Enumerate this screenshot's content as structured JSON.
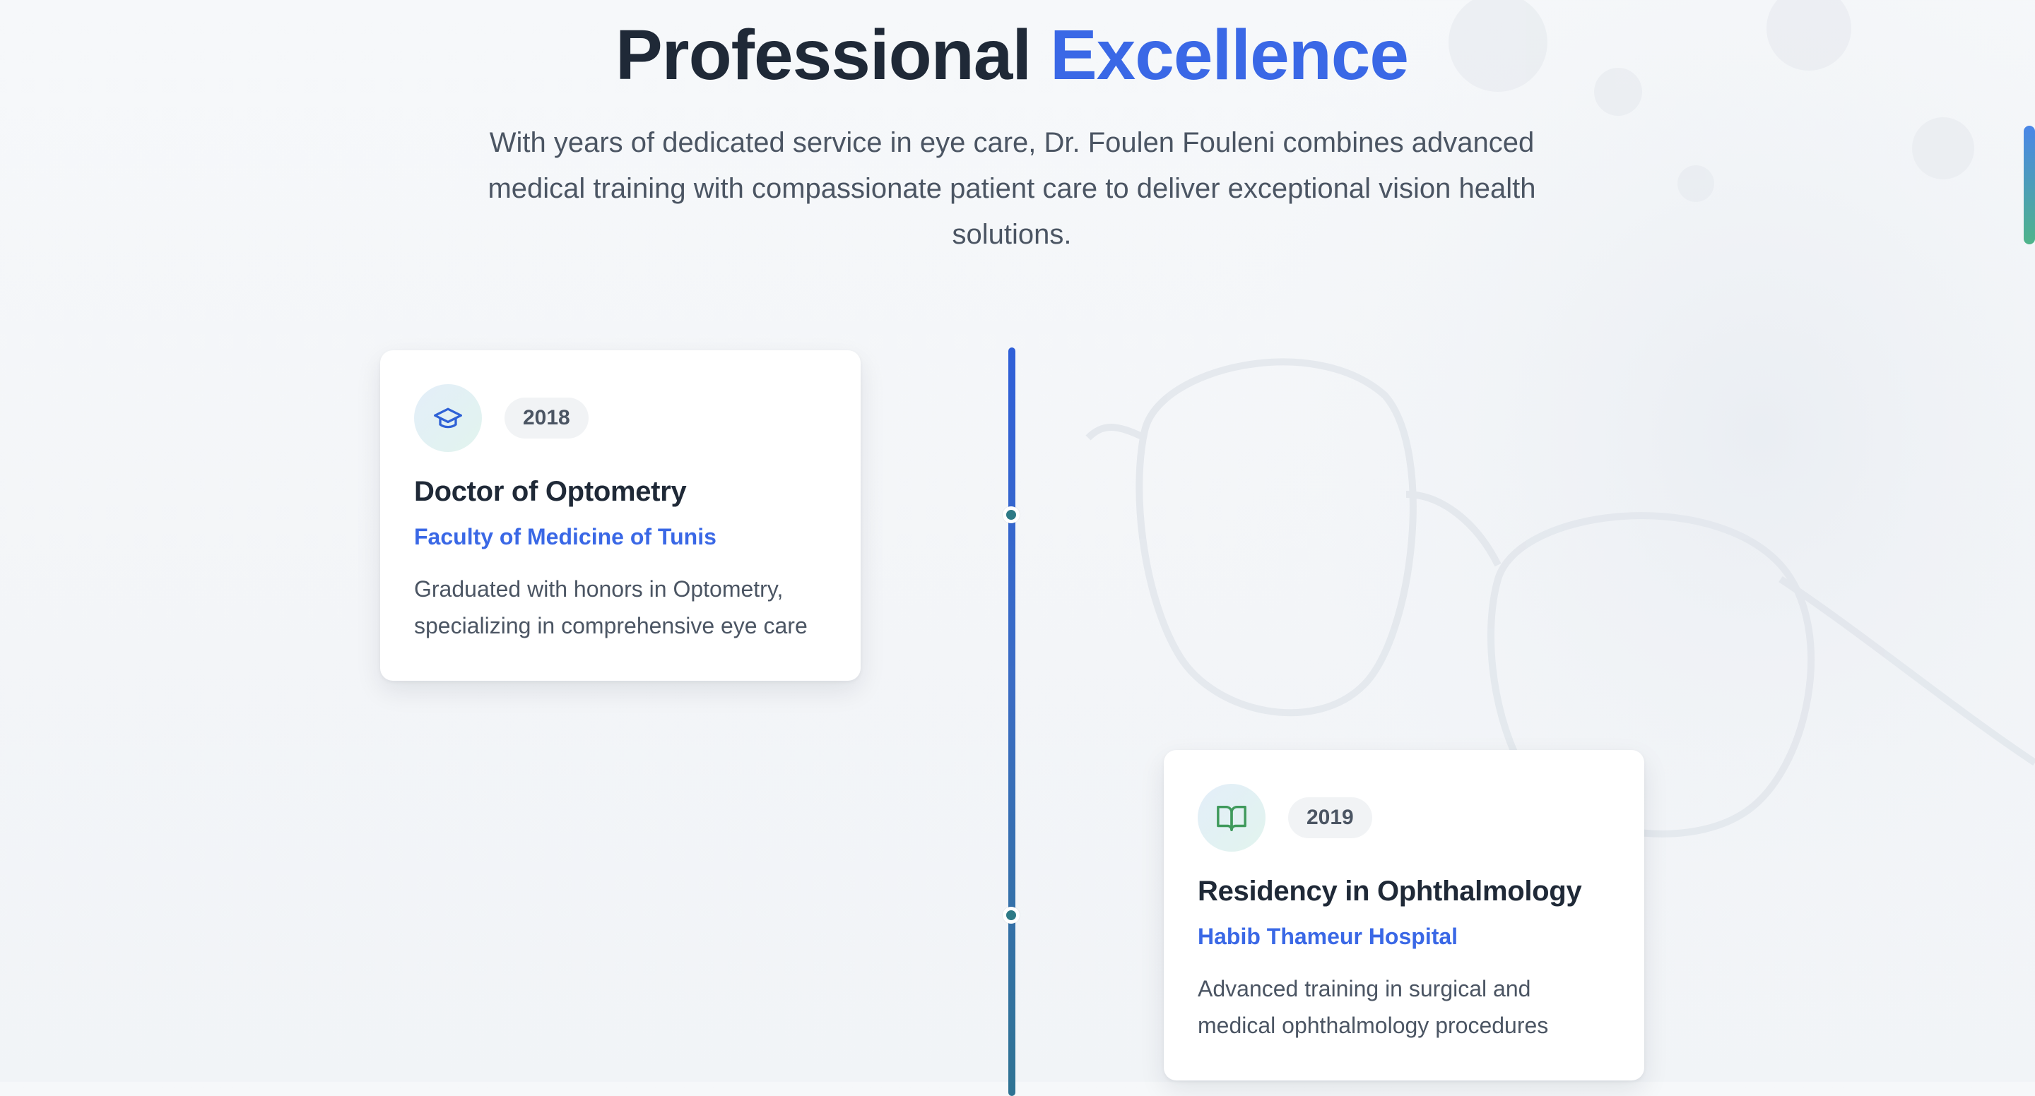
{
  "header": {
    "title_part1": "Professional",
    "title_part2": "Excellence",
    "intro": "With years of dedicated service in eye care, Dr. Foulen Fouleni combines advanced medical training with compassionate patient care to deliver exceptional vision health solutions."
  },
  "timeline": [
    {
      "icon": "graduation-cap-icon",
      "year": "2018",
      "title": "Doctor of Optometry",
      "organization": "Faculty of Medicine of Tunis",
      "description": "Graduated with honors in Optometry, specializing in comprehensive eye care"
    },
    {
      "icon": "open-book-icon",
      "year": "2019",
      "title": "Residency in Ophthalmology",
      "organization": "Habib Thameur Hospital",
      "description": "Advanced training in surgical and medical ophthalmology procedures"
    }
  ],
  "colors": {
    "accent": "#3a68e6",
    "heading": "#1f2937",
    "body_text": "#4b5563",
    "timeline_top": "#2f5fd8",
    "timeline_bottom": "#2f7393",
    "scroll_top": "#4a86e8",
    "scroll_bottom": "#4fb48a",
    "icon_blue": "#2f62d6",
    "icon_green": "#3f9a5c"
  }
}
